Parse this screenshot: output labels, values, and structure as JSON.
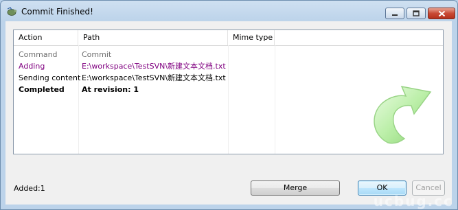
{
  "window": {
    "title": "Commit Finished!"
  },
  "list": {
    "columns": [
      "Action",
      "Path",
      "Mime type"
    ],
    "rows": [
      {
        "action": "Command",
        "path": "Commit",
        "style": "gray"
      },
      {
        "action": "Adding",
        "path": "E:\\workspace\\TestSVN\\新建文本文档.txt",
        "style": "purple"
      },
      {
        "action": "Sending content",
        "path": "E:\\workspace\\TestSVN\\新建文本文档.txt",
        "style": "normal"
      },
      {
        "action": "Completed",
        "path": "At revision: 1",
        "style": "bold"
      }
    ]
  },
  "status": {
    "text": "Added:1"
  },
  "buttons": {
    "merge": "Merge",
    "ok": "OK",
    "cancel": "Cancel"
  },
  "watermark": "ucbug.cc",
  "colors": {
    "adding": "#800080",
    "arrow": "#9be07f",
    "title_bar": "#bcd3ea"
  },
  "icons": [
    "tortoise-svn-icon",
    "minimize-icon",
    "maximize-icon",
    "close-icon",
    "curved-arrow-icon"
  ]
}
